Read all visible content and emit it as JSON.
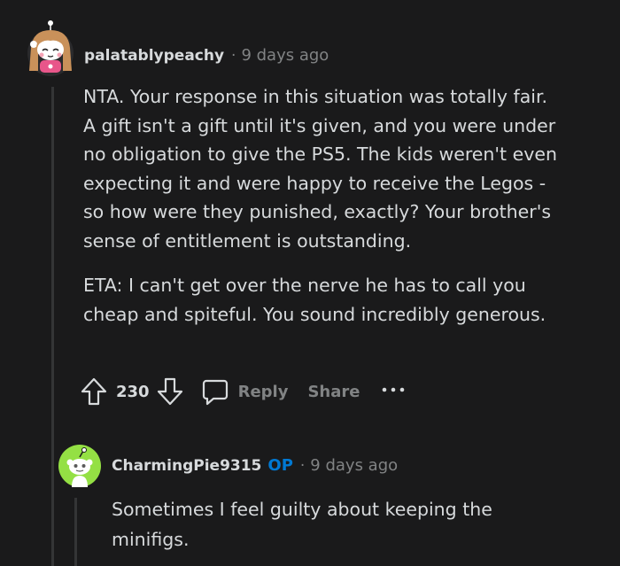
{
  "comment": {
    "username": "palatablypeachy",
    "time": "9 days ago",
    "paragraphs": [
      [
        "NTA. Your response in this situation was totally fair.",
        "A gift isn't a gift until it's given, and you were under",
        "no obligation to give the PS5. The kids weren't even",
        "expecting it and were happy to receive the Legos -",
        "so how were they punished, exactly? Your brother's",
        "sense of entitlement is outstanding."
      ],
      [
        "ETA: I can't get over the nerve he has to call you",
        "cheap and spiteful. You sound incredibly generous."
      ]
    ],
    "votes": "230",
    "reply_label": "Reply",
    "share_label": "Share",
    "avatar_icon": "girl-snoo-avatar-icon"
  },
  "reply": {
    "username": "CharmingPie9315",
    "op_badge": "OP",
    "time": "9 days ago",
    "lines": [
      "Sometimes I feel guilty about keeping the",
      "minifigs."
    ],
    "avatar_icon": "default-snoo-avatar-icon"
  },
  "icons": {
    "upvote": "upvote-arrow-icon",
    "downvote": "downvote-arrow-icon",
    "reply": "chat-bubble-icon",
    "more": "more-dots-icon"
  },
  "colors": {
    "background": "#1a1a1b",
    "text": "#d7dadc",
    "muted": "#818384",
    "op_blue": "#0079d3",
    "avatar_green": "#94e044"
  }
}
